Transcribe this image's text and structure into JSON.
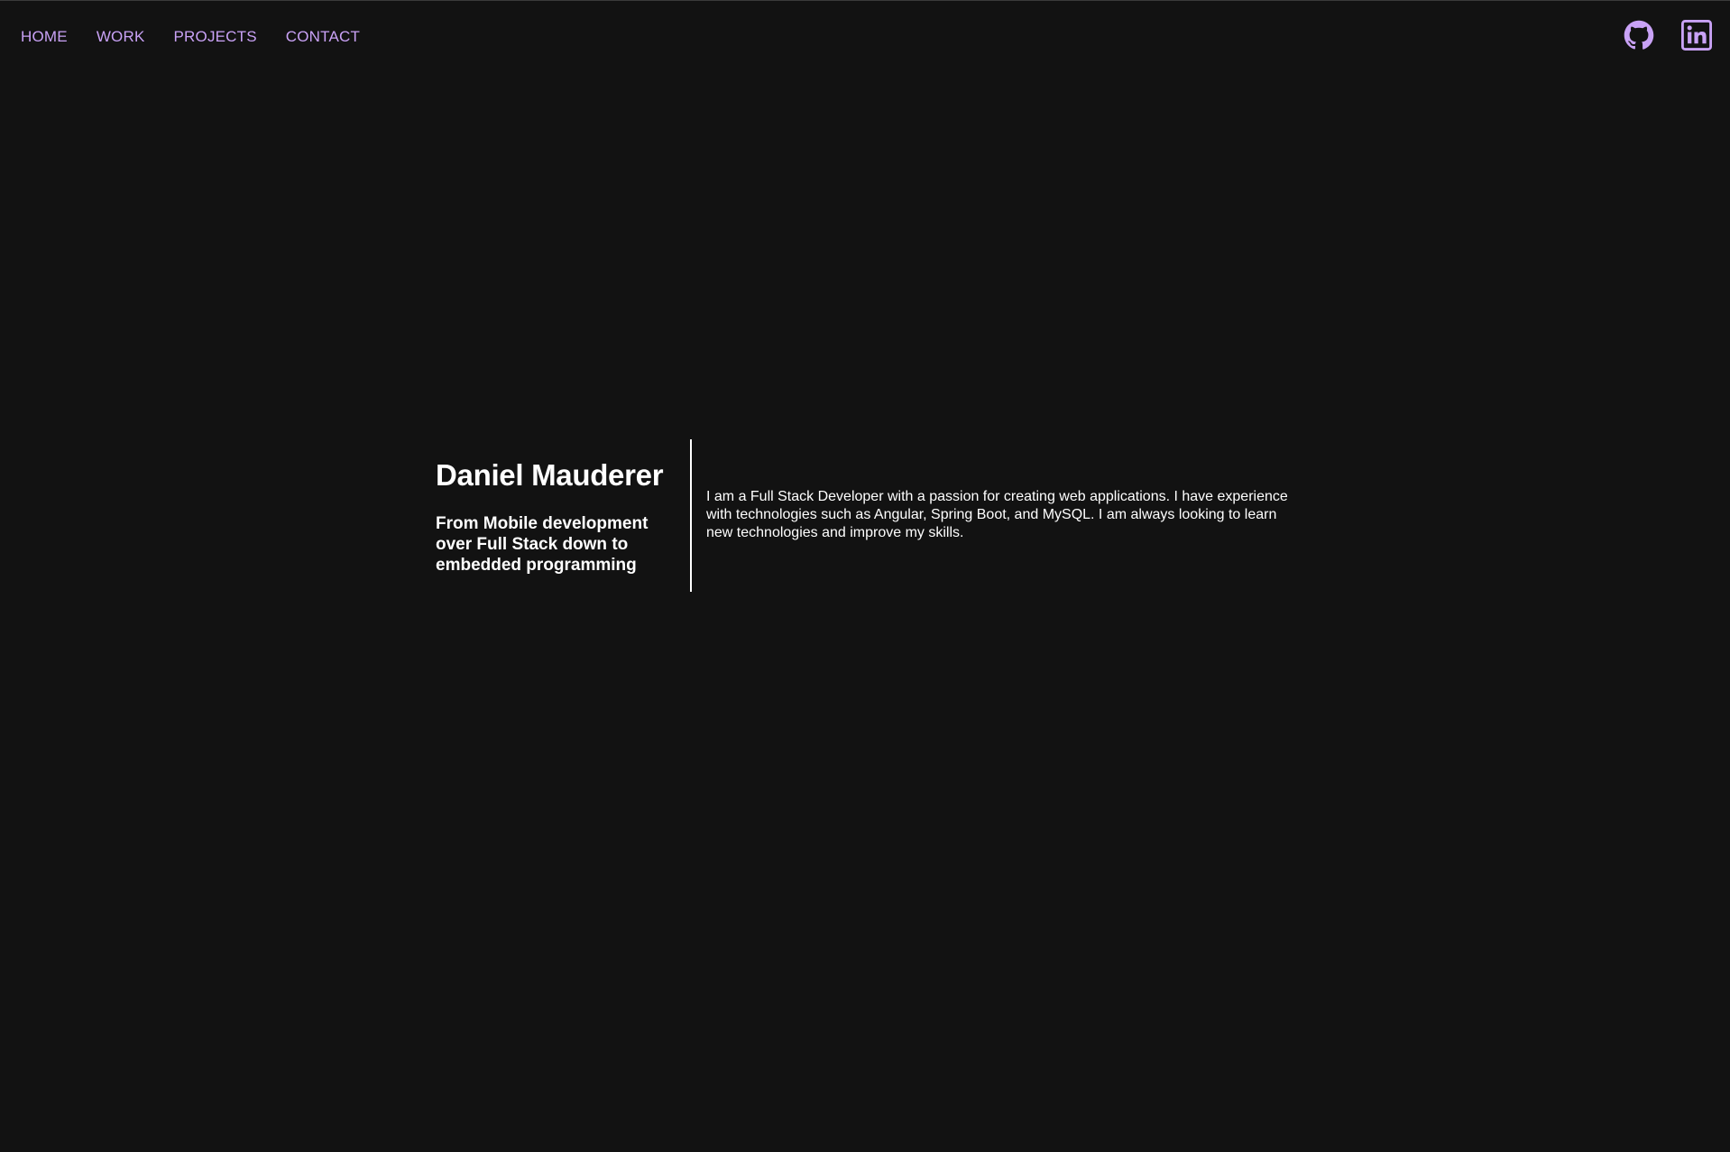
{
  "nav": {
    "items": [
      {
        "label": "HOME"
      },
      {
        "label": "WORK"
      },
      {
        "label": "PROJECTS"
      },
      {
        "label": "CONTACT"
      }
    ]
  },
  "socials": {
    "icons": [
      "github-icon",
      "linkedin-icon"
    ],
    "accent_color": "#c9a2f6"
  },
  "hero": {
    "name": "Daniel Mauderer",
    "tagline": "From Mobile development over Full Stack down to embedded programming",
    "bio": "I am a Full Stack Developer with a passion for creating web applications. I have experience with technologies such as Angular, Spring Boot, and MySQL. I am always looking to learn new technologies and improve my skills."
  },
  "colors": {
    "background": "#121212",
    "text": "#ffffff",
    "accent": "#c9a2f6"
  }
}
